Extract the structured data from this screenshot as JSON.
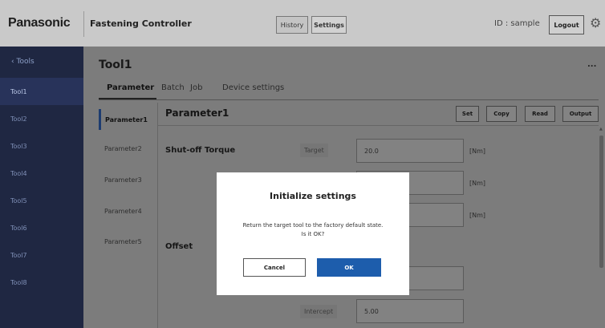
{
  "header": {
    "logo": "Panasonic",
    "app_title": "Fastening Controller",
    "tabs": [
      {
        "label": "History",
        "active": false
      },
      {
        "label": "Settings",
        "active": true
      }
    ],
    "user_id": "ID : sample",
    "logout_label": "Logout",
    "settings_icon": "gear-icon"
  },
  "sidebar": {
    "back_label": "Tools",
    "back_icon": "chevron-left-icon",
    "items": [
      {
        "label": "Tool1",
        "active": true
      },
      {
        "label": "Tool2",
        "active": false
      },
      {
        "label": "Tool3",
        "active": false
      },
      {
        "label": "Tool4",
        "active": false
      },
      {
        "label": "Tool5",
        "active": false
      },
      {
        "label": "Tool6",
        "active": false
      },
      {
        "label": "Tool7",
        "active": false
      },
      {
        "label": "Tool8",
        "active": false
      }
    ]
  },
  "main": {
    "tool_title": "Tool1",
    "more_label": "...",
    "tabs": [
      {
        "label": "Parameter",
        "active": true
      },
      {
        "label": "Batch",
        "active": false
      },
      {
        "label": "Job",
        "active": false
      },
      {
        "label": "Device settings",
        "active": false
      }
    ],
    "parameters": [
      {
        "label": "Parameter1",
        "active": true
      },
      {
        "label": "Parameter2",
        "active": false
      },
      {
        "label": "Parameter3",
        "active": false
      },
      {
        "label": "Parameter4",
        "active": false
      },
      {
        "label": "Parameter5",
        "active": false
      }
    ],
    "param_title": "Parameter1",
    "actions": {
      "set": "Set",
      "copy": "Copy",
      "read": "Read",
      "output": "Output"
    },
    "shutoff": {
      "section": "Shut-off Torque",
      "target_label": "Target",
      "target_value": "20.0",
      "unit": "[Nm]"
    },
    "extra_units": [
      "[Nm]",
      "[Nm]"
    ],
    "offset": {
      "section": "Offset",
      "intercept_label": "Intercept",
      "intercept_value": "5.00"
    }
  },
  "modal": {
    "title": "Initialize settings",
    "message_line1": "Return the target tool to the factory default state.",
    "message_line2": "Is it OK?",
    "cancel_label": "Cancel",
    "ok_label": "OK"
  },
  "colors": {
    "sidebar_bg": "#1f2742",
    "ok_button": "#1d5dac",
    "overlay": "#7a7a7a"
  }
}
